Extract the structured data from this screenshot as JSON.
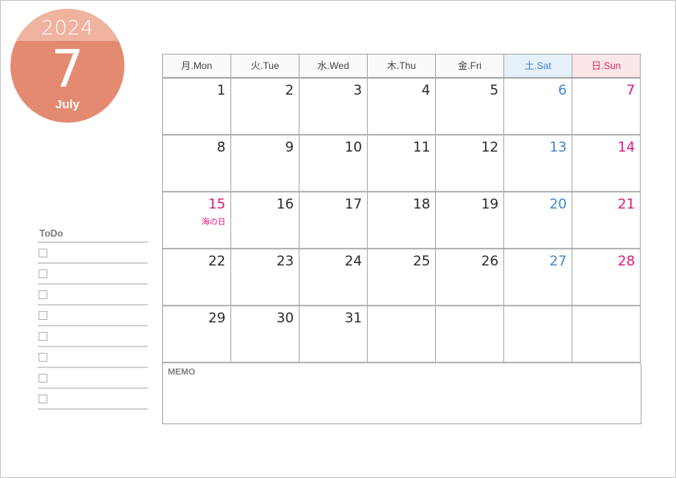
{
  "badge": {
    "year": "2024",
    "month_number": "7",
    "month_name": "July",
    "colors": {
      "top": "#efb39f",
      "body": "#e48a70"
    }
  },
  "todo": {
    "title": "ToDo",
    "item_count": 8,
    "items": [
      "",
      "",
      "",
      "",
      "",
      "",
      "",
      ""
    ]
  },
  "calendar": {
    "weekdays": [
      {
        "label": "月.Mon",
        "type": "weekday"
      },
      {
        "label": "火.Tue",
        "type": "weekday"
      },
      {
        "label": "水.Wed",
        "type": "weekday"
      },
      {
        "label": "木.Thu",
        "type": "weekday"
      },
      {
        "label": "金.Fri",
        "type": "weekday"
      },
      {
        "label": "土.Sat",
        "type": "sat"
      },
      {
        "label": "日.Sun",
        "type": "sun"
      }
    ],
    "weeks": [
      [
        "1",
        "2",
        "3",
        "4",
        "5",
        "6",
        "7"
      ],
      [
        "8",
        "9",
        "10",
        "11",
        "12",
        "13",
        "14"
      ],
      [
        "15",
        "16",
        "17",
        "18",
        "19",
        "20",
        "21"
      ],
      [
        "22",
        "23",
        "24",
        "25",
        "26",
        "27",
        "28"
      ],
      [
        "29",
        "30",
        "31",
        "",
        "",
        "",
        ""
      ]
    ],
    "holidays": [
      {
        "day": "15",
        "name": "海の日"
      }
    ],
    "colors": {
      "saturday": "#3f86c9",
      "sunday_holiday": "#e0177a",
      "normal": "#2b2b2b"
    }
  },
  "memo": {
    "label": "MEMO"
  }
}
